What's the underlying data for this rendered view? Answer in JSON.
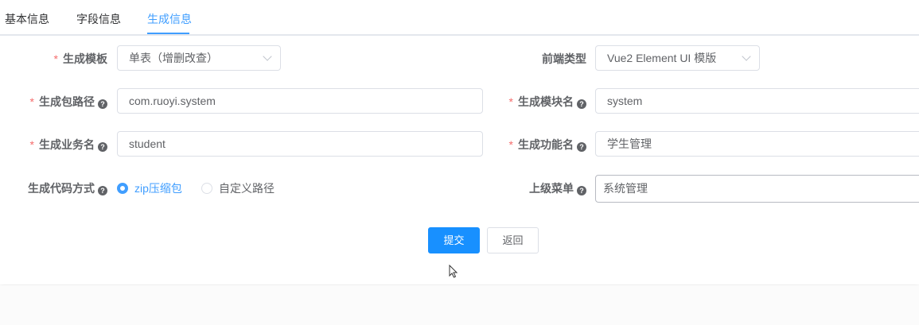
{
  "tabs": [
    {
      "label": "基本信息",
      "active": false
    },
    {
      "label": "字段信息",
      "active": false
    },
    {
      "label": "生成信息",
      "active": true
    }
  ],
  "form": {
    "tpl_category": {
      "label": "生成模板",
      "required": true,
      "value": "单表（增删改查）"
    },
    "frontend_type": {
      "label": "前端类型",
      "required": false,
      "value": "Vue2 Element UI 模版"
    },
    "package_name": {
      "label": "生成包路径",
      "required": true,
      "value": "com.ruoyi.system",
      "help": "?"
    },
    "module_name": {
      "label": "生成模块名",
      "required": true,
      "value": "system",
      "help": "?"
    },
    "business_name": {
      "label": "生成业务名",
      "required": true,
      "value": "student",
      "help": "?"
    },
    "function_name": {
      "label": "生成功能名",
      "required": true,
      "value": "学生管理",
      "help": "?"
    },
    "gen_type": {
      "label": "生成代码方式",
      "help": "?",
      "options": [
        {
          "label": "zip压缩包",
          "checked": true
        },
        {
          "label": "自定义路径",
          "checked": false
        }
      ]
    },
    "parent_menu": {
      "label": "上级菜单",
      "value": "系统管理",
      "help": "?"
    }
  },
  "required_mark": "*",
  "buttons": {
    "submit": "提交",
    "back": "返回"
  },
  "colors": {
    "primary": "#409eff",
    "button_primary": "#1890ff",
    "required": "#f56c6c",
    "text": "#606266"
  }
}
